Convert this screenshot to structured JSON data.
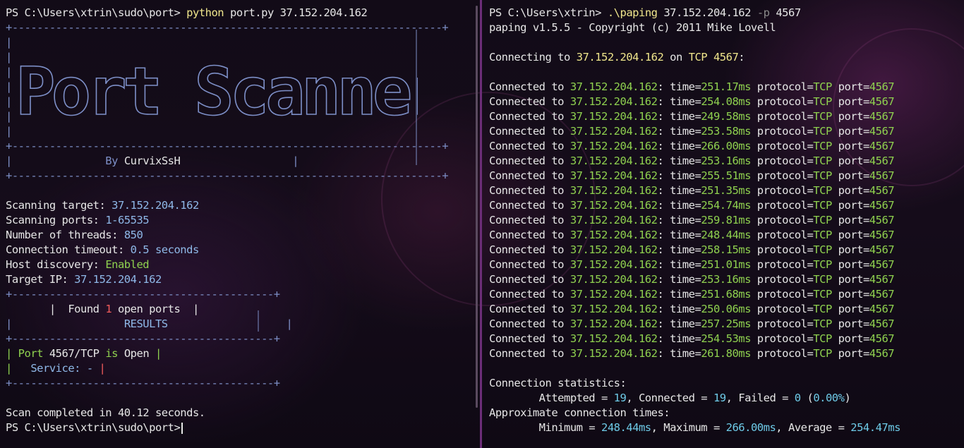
{
  "left": {
    "prompt": "PS C:\\Users\\xtrin\\sudo\\port>",
    "command": "python",
    "command_args": "port.py 37.152.204.162",
    "banner_top": "+---------------------------------------------------------------------+",
    "banner_side_left": "|",
    "banner_side_right": "|",
    "logo_text": "Port Scanner",
    "banner_mid": "+---------------------------------------------------------------------+",
    "by_prefix": "|               By",
    "by_author": "CurvixSsH",
    "by_suffix": "                  |",
    "banner_bottom": "+---------------------------------------------------------------------+",
    "info": [
      {
        "label": "Scanning target: ",
        "value": "37.152.204.162"
      },
      {
        "label": "Scanning ports: ",
        "value": "1-65535"
      },
      {
        "label": "Number of threads: ",
        "value": "850"
      },
      {
        "label": "Connection timeout: ",
        "value": "0.5 seconds"
      },
      {
        "label": "Host discovery: ",
        "value": "Enabled"
      },
      {
        "label": "Target IP: ",
        "value": "37.152.204.162"
      }
    ],
    "results_top": "+------------------------------------------+",
    "found_pre": "       |  Found ",
    "found_count": "1",
    "found_post": " open ports  |",
    "results_label_pre": "|                  ",
    "results_label": "RESULTS",
    "results_label_post": "                   |",
    "results_mid": "+------------------------------------------+",
    "port_pre": "| ",
    "port_word": "Port",
    "port_value": " 4567/TCP ",
    "port_is": "is",
    "port_status": " Open ",
    "port_post": "|",
    "service_pre": "|   ",
    "service_label": "Service: -",
    "service_post": " |",
    "results_bottom": "+------------------------------------------+",
    "scan_done": "Scan completed in 40.12 seconds.",
    "final_prompt": "PS C:\\Users\\xtrin\\sudo\\port>"
  },
  "right": {
    "prompt": "PS C:\\Users\\xtrin>",
    "command": ".\\paping",
    "command_ip": "37.152.204.162",
    "command_flag": "-p",
    "command_port": "4567",
    "version": "paping v1.5.5 - Copyright (c) 2011 Mike Lovell",
    "connecting_pre": "Connecting to ",
    "connecting_ip": "37.152.204.162",
    "connecting_on": " on ",
    "connecting_port": "TCP 4567",
    "connecting_post": ":",
    "conn_prefix": "Connected to ",
    "conn_ip": "37.152.204.162",
    "conn_time_label": ": time=",
    "conn_proto_label": " protocol=",
    "conn_proto": "TCP",
    "conn_port_label": " port=",
    "conn_port": "4567",
    "times": [
      "251.17ms",
      "254.08ms",
      "249.58ms",
      "253.58ms",
      "266.00ms",
      "253.16ms",
      "255.51ms",
      "251.35ms",
      "254.74ms",
      "259.81ms",
      "248.44ms",
      "258.15ms",
      "251.01ms",
      "253.16ms",
      "251.68ms",
      "250.06ms",
      "257.25ms",
      "254.53ms",
      "261.80ms"
    ],
    "stats_title": "Connection statistics:",
    "attempted_label": "        Attempted = ",
    "attempted": "19",
    "connected_label": ", Connected = ",
    "connected": "19",
    "failed_label": ", Failed = ",
    "failed": "0",
    "failed_pct_open": " (",
    "failed_pct": "0.00%",
    "failed_pct_close": ")",
    "approx_title": "Approximate connection times:",
    "min_label": "        Minimum = ",
    "min": "248.44ms",
    "max_label": ", Maximum = ",
    "max": "266.00ms",
    "avg_label": ", Average = ",
    "avg": "254.47ms"
  }
}
